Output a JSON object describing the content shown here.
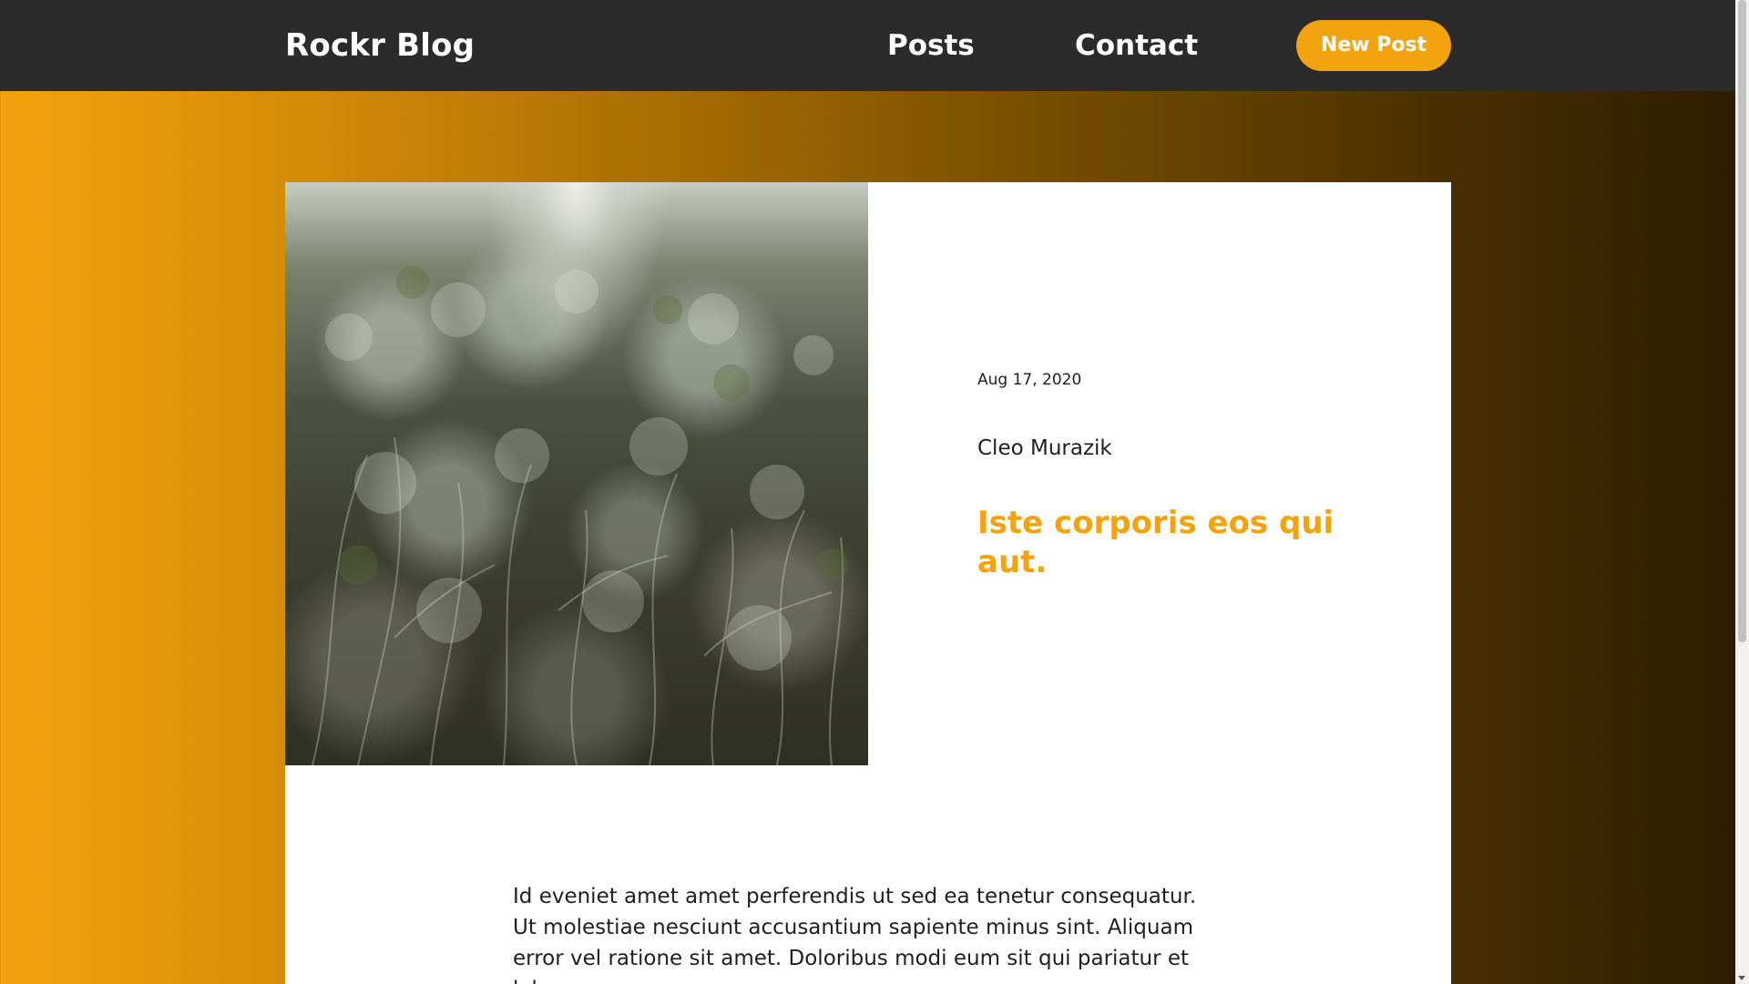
{
  "header": {
    "brand": "Rockr Blog",
    "nav": [
      {
        "label": "Posts"
      },
      {
        "label": "Contact"
      }
    ],
    "cta_label": "New Post"
  },
  "post": {
    "date": "Aug 17, 2020",
    "author": "Cleo Murazik",
    "title": "Iste corporis eos qui aut.",
    "excerpt": "Id eveniet amet amet perferendis ut sed ea tenetur consequatur. Ut molestiae nesciunt accusantium sapiente minus sint. Aliquam error vel ratione sit amet. Doloribus modi eum sit qui pariatur et labore",
    "image": "frost-covered-shrubs-photo"
  },
  "colors": {
    "accent": "#f3a30d",
    "header_bg": "#2b2b2b",
    "card_bg": "#ffffff",
    "gradient_start": "#f3a30d",
    "gradient_end": "#2c1c00"
  }
}
